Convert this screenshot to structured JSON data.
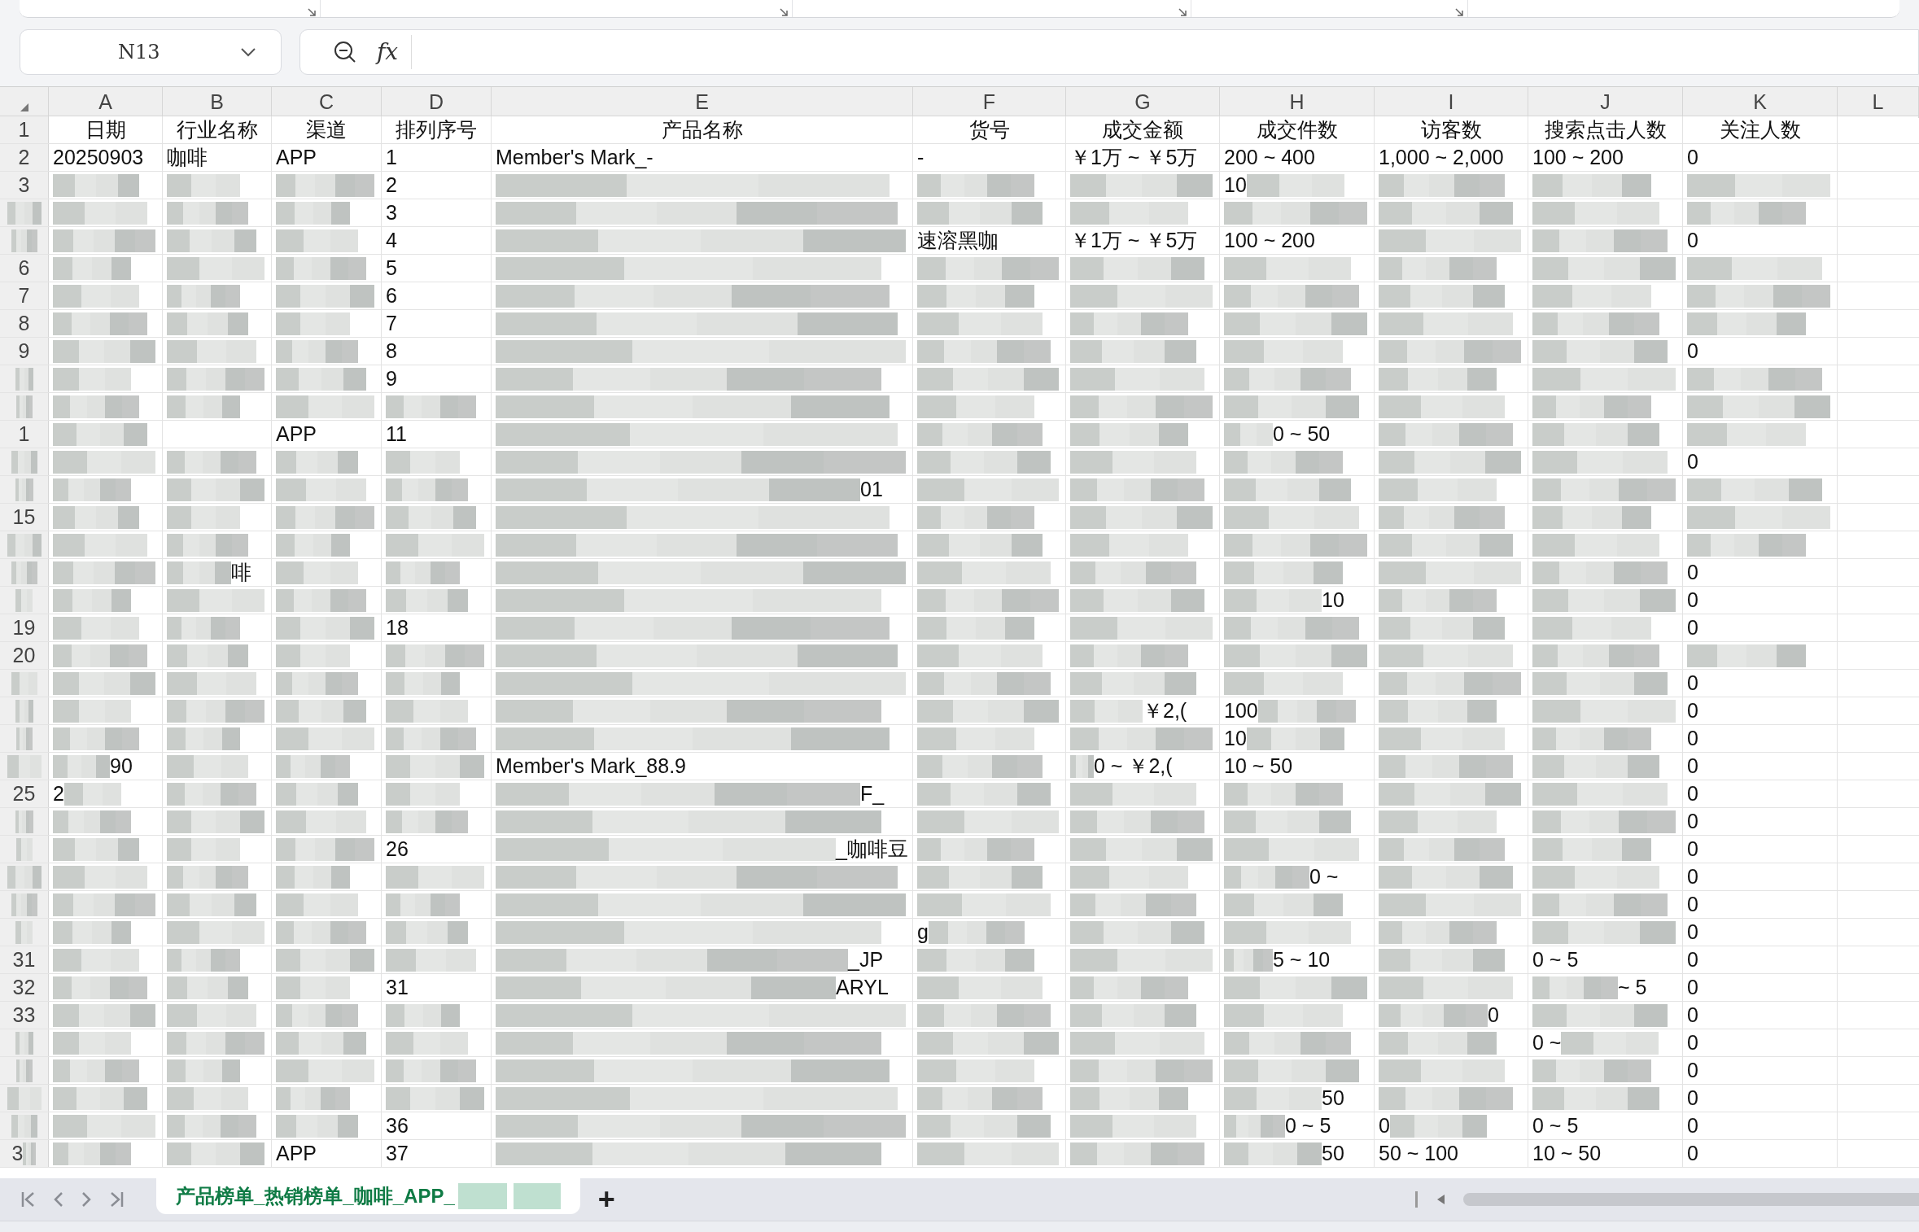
{
  "name_box": {
    "value": "N13"
  },
  "formula_bar": {
    "label": "fx"
  },
  "columns": [
    "A",
    "B",
    "C",
    "D",
    "E",
    "F",
    "G",
    "H",
    "I",
    "J",
    "K",
    "L"
  ],
  "rows": [
    {
      "header": {
        "kind": "text",
        "text": "1"
      },
      "cells": [
        {
          "kind": "text",
          "text": "日期"
        },
        {
          "kind": "text",
          "text": "行业名称"
        },
        {
          "kind": "text",
          "text": "渠道"
        },
        {
          "kind": "text",
          "text": "排列序号"
        },
        {
          "kind": "text",
          "text": "产品名称"
        },
        {
          "kind": "text",
          "text": "货号"
        },
        {
          "kind": "text",
          "text": "成交金额"
        },
        {
          "kind": "text",
          "text": "成交件数"
        },
        {
          "kind": "text",
          "text": "访客数"
        },
        {
          "kind": "text",
          "text": "搜索点击人数"
        },
        {
          "kind": "text",
          "text": "关注人数"
        }
      ]
    },
    {
      "header": {
        "kind": "text",
        "text": "2"
      },
      "cells": [
        {
          "kind": "text",
          "text": "20250903"
        },
        {
          "kind": "text",
          "text": "咖啡"
        },
        {
          "kind": "text",
          "text": "APP"
        },
        {
          "kind": "text",
          "text": "1"
        },
        {
          "kind": "text",
          "text": "Member's Mark_-"
        },
        {
          "kind": "text",
          "text": "-"
        },
        {
          "kind": "text",
          "text": "￥1万 ~ ￥5万"
        },
        {
          "kind": "text",
          "text": "200 ~ 400"
        },
        {
          "kind": "text",
          "text": "1,000 ~ 2,000"
        },
        {
          "kind": "text",
          "text": "100 ~ 200"
        },
        {
          "kind": "text",
          "text": "0"
        }
      ]
    },
    {
      "header": {
        "kind": "text",
        "text": "3"
      },
      "cells": [
        {
          "kind": "redacted"
        },
        {
          "kind": "redacted"
        },
        {
          "kind": "redacted"
        },
        {
          "kind": "text",
          "text": "2"
        },
        {
          "kind": "redacted"
        },
        {
          "kind": "redacted"
        },
        {
          "kind": "redacted"
        },
        {
          "kind": "tail_hidden",
          "text": "10"
        },
        {
          "kind": "redacted"
        },
        {
          "kind": "redacted"
        },
        {
          "kind": "redacted"
        }
      ]
    },
    {
      "header": {
        "kind": "redacted"
      },
      "cells": [
        {
          "kind": "redacted"
        },
        {
          "kind": "redacted"
        },
        {
          "kind": "redacted"
        },
        {
          "kind": "text",
          "text": "3"
        },
        {
          "kind": "redacted"
        },
        {
          "kind": "redacted"
        },
        {
          "kind": "redacted"
        },
        {
          "kind": "redacted"
        },
        {
          "kind": "redacted"
        },
        {
          "kind": "redacted"
        },
        {
          "kind": "redacted"
        }
      ]
    },
    {
      "header": {
        "kind": "redacted"
      },
      "cells": [
        {
          "kind": "redacted"
        },
        {
          "kind": "redacted"
        },
        {
          "kind": "redacted"
        },
        {
          "kind": "text",
          "text": "4"
        },
        {
          "kind": "redacted"
        },
        {
          "kind": "text",
          "text": "速溶黑咖"
        },
        {
          "kind": "text",
          "text": "￥1万 ~ ￥5万"
        },
        {
          "kind": "text",
          "text": "100 ~ 200"
        },
        {
          "kind": "redacted"
        },
        {
          "kind": "redacted"
        },
        {
          "kind": "text",
          "text": "0"
        }
      ]
    },
    {
      "header": {
        "kind": "text",
        "text": "6"
      },
      "cells": [
        {
          "kind": "redacted"
        },
        {
          "kind": "redacted"
        },
        {
          "kind": "redacted"
        },
        {
          "kind": "text",
          "text": "5"
        },
        {
          "kind": "redacted"
        },
        {
          "kind": "redacted"
        },
        {
          "kind": "redacted"
        },
        {
          "kind": "redacted"
        },
        {
          "kind": "redacted"
        },
        {
          "kind": "redacted"
        },
        {
          "kind": "redacted"
        }
      ]
    },
    {
      "header": {
        "kind": "text",
        "text": "7"
      },
      "cells": [
        {
          "kind": "redacted"
        },
        {
          "kind": "redacted"
        },
        {
          "kind": "redacted"
        },
        {
          "kind": "text",
          "text": "6"
        },
        {
          "kind": "redacted"
        },
        {
          "kind": "redacted"
        },
        {
          "kind": "redacted"
        },
        {
          "kind": "redacted"
        },
        {
          "kind": "redacted"
        },
        {
          "kind": "redacted"
        },
        {
          "kind": "redacted"
        }
      ]
    },
    {
      "header": {
        "kind": "text",
        "text": "8"
      },
      "cells": [
        {
          "kind": "redacted"
        },
        {
          "kind": "redacted"
        },
        {
          "kind": "redacted"
        },
        {
          "kind": "text",
          "text": "7"
        },
        {
          "kind": "redacted"
        },
        {
          "kind": "redacted"
        },
        {
          "kind": "redacted"
        },
        {
          "kind": "redacted"
        },
        {
          "kind": "redacted"
        },
        {
          "kind": "redacted"
        },
        {
          "kind": "redacted"
        }
      ]
    },
    {
      "header": {
        "kind": "text",
        "text": "9"
      },
      "cells": [
        {
          "kind": "redacted"
        },
        {
          "kind": "redacted"
        },
        {
          "kind": "redacted"
        },
        {
          "kind": "text",
          "text": "8"
        },
        {
          "kind": "redacted"
        },
        {
          "kind": "redacted"
        },
        {
          "kind": "redacted"
        },
        {
          "kind": "redacted"
        },
        {
          "kind": "redacted"
        },
        {
          "kind": "redacted"
        },
        {
          "kind": "text",
          "text": "0"
        }
      ]
    },
    {
      "header": {
        "kind": "redacted"
      },
      "cells": [
        {
          "kind": "redacted"
        },
        {
          "kind": "redacted"
        },
        {
          "kind": "redacted"
        },
        {
          "kind": "text",
          "text": "9"
        },
        {
          "kind": "redacted"
        },
        {
          "kind": "redacted"
        },
        {
          "kind": "redacted"
        },
        {
          "kind": "redacted"
        },
        {
          "kind": "redacted"
        },
        {
          "kind": "redacted"
        },
        {
          "kind": "redacted"
        }
      ]
    },
    {
      "header": {
        "kind": "redacted"
      },
      "cells": [
        {
          "kind": "redacted"
        },
        {
          "kind": "redacted"
        },
        {
          "kind": "redacted"
        },
        {
          "kind": "redacted"
        },
        {
          "kind": "redacted"
        },
        {
          "kind": "redacted"
        },
        {
          "kind": "redacted"
        },
        {
          "kind": "redacted"
        },
        {
          "kind": "redacted"
        },
        {
          "kind": "redacted"
        },
        {
          "kind": "redacted"
        }
      ]
    },
    {
      "header": {
        "kind": "text",
        "text": "1"
      },
      "cells": [
        {
          "kind": "redacted"
        },
        {
          "kind": "empty"
        },
        {
          "kind": "text",
          "text": "APP"
        },
        {
          "kind": "text",
          "text": "11"
        },
        {
          "kind": "redacted"
        },
        {
          "kind": "redacted"
        },
        {
          "kind": "redacted"
        },
        {
          "kind": "head_hidden",
          "text": "0 ~ 50"
        },
        {
          "kind": "redacted"
        },
        {
          "kind": "redacted"
        },
        {
          "kind": "redacted"
        }
      ]
    },
    {
      "header": {
        "kind": "redacted"
      },
      "cells": [
        {
          "kind": "redacted"
        },
        {
          "kind": "redacted"
        },
        {
          "kind": "redacted"
        },
        {
          "kind": "redacted"
        },
        {
          "kind": "redacted"
        },
        {
          "kind": "redacted"
        },
        {
          "kind": "redacted"
        },
        {
          "kind": "redacted"
        },
        {
          "kind": "redacted"
        },
        {
          "kind": "redacted"
        },
        {
          "kind": "text",
          "text": "0"
        }
      ]
    },
    {
      "header": {
        "kind": "redacted"
      },
      "cells": [
        {
          "kind": "redacted"
        },
        {
          "kind": "redacted"
        },
        {
          "kind": "redacted"
        },
        {
          "kind": "redacted"
        },
        {
          "kind": "head_hidden",
          "text": "01"
        },
        {
          "kind": "redacted"
        },
        {
          "kind": "redacted"
        },
        {
          "kind": "redacted"
        },
        {
          "kind": "redacted"
        },
        {
          "kind": "redacted"
        },
        {
          "kind": "redacted"
        }
      ]
    },
    {
      "header": {
        "kind": "text",
        "text": "15"
      },
      "cells": [
        {
          "kind": "redacted"
        },
        {
          "kind": "redacted"
        },
        {
          "kind": "redacted"
        },
        {
          "kind": "redacted"
        },
        {
          "kind": "redacted"
        },
        {
          "kind": "redacted"
        },
        {
          "kind": "redacted"
        },
        {
          "kind": "redacted"
        },
        {
          "kind": "redacted"
        },
        {
          "kind": "redacted"
        },
        {
          "kind": "redacted"
        }
      ]
    },
    {
      "header": {
        "kind": "redacted"
      },
      "cells": [
        {
          "kind": "redacted"
        },
        {
          "kind": "redacted"
        },
        {
          "kind": "redacted"
        },
        {
          "kind": "redacted"
        },
        {
          "kind": "redacted"
        },
        {
          "kind": "redacted"
        },
        {
          "kind": "redacted"
        },
        {
          "kind": "redacted"
        },
        {
          "kind": "redacted"
        },
        {
          "kind": "redacted"
        },
        {
          "kind": "redacted"
        }
      ]
    },
    {
      "header": {
        "kind": "redacted"
      },
      "cells": [
        {
          "kind": "redacted"
        },
        {
          "kind": "head_hidden",
          "text": "啡"
        },
        {
          "kind": "redacted"
        },
        {
          "kind": "redacted"
        },
        {
          "kind": "redacted"
        },
        {
          "kind": "redacted"
        },
        {
          "kind": "redacted"
        },
        {
          "kind": "redacted"
        },
        {
          "kind": "redacted"
        },
        {
          "kind": "redacted"
        },
        {
          "kind": "text",
          "text": "0"
        }
      ]
    },
    {
      "header": {
        "kind": "redacted"
      },
      "cells": [
        {
          "kind": "redacted"
        },
        {
          "kind": "redacted"
        },
        {
          "kind": "redacted"
        },
        {
          "kind": "redacted"
        },
        {
          "kind": "redacted"
        },
        {
          "kind": "redacted"
        },
        {
          "kind": "redacted"
        },
        {
          "kind": "head_hidden",
          "text": "10"
        },
        {
          "kind": "redacted"
        },
        {
          "kind": "redacted"
        },
        {
          "kind": "text",
          "text": "0"
        }
      ]
    },
    {
      "header": {
        "kind": "text",
        "text": "19"
      },
      "cells": [
        {
          "kind": "redacted"
        },
        {
          "kind": "redacted"
        },
        {
          "kind": "redacted"
        },
        {
          "kind": "text",
          "text": "18"
        },
        {
          "kind": "redacted"
        },
        {
          "kind": "redacted"
        },
        {
          "kind": "redacted"
        },
        {
          "kind": "redacted"
        },
        {
          "kind": "redacted"
        },
        {
          "kind": "redacted"
        },
        {
          "kind": "text",
          "text": "0"
        }
      ]
    },
    {
      "header": {
        "kind": "text",
        "text": "20"
      },
      "cells": [
        {
          "kind": "redacted"
        },
        {
          "kind": "redacted"
        },
        {
          "kind": "redacted"
        },
        {
          "kind": "redacted"
        },
        {
          "kind": "redacted"
        },
        {
          "kind": "redacted"
        },
        {
          "kind": "redacted"
        },
        {
          "kind": "redacted"
        },
        {
          "kind": "redacted"
        },
        {
          "kind": "redacted"
        },
        {
          "kind": "redacted"
        }
      ]
    },
    {
      "header": {
        "kind": "redacted"
      },
      "cells": [
        {
          "kind": "redacted"
        },
        {
          "kind": "redacted"
        },
        {
          "kind": "redacted"
        },
        {
          "kind": "redacted"
        },
        {
          "kind": "redacted"
        },
        {
          "kind": "redacted"
        },
        {
          "kind": "redacted"
        },
        {
          "kind": "redacted"
        },
        {
          "kind": "redacted"
        },
        {
          "kind": "redacted"
        },
        {
          "kind": "text",
          "text": "0"
        }
      ]
    },
    {
      "header": {
        "kind": "redacted"
      },
      "cells": [
        {
          "kind": "redacted"
        },
        {
          "kind": "redacted"
        },
        {
          "kind": "redacted"
        },
        {
          "kind": "redacted"
        },
        {
          "kind": "redacted"
        },
        {
          "kind": "redacted"
        },
        {
          "kind": "head_hidden",
          "text": "￥2,("
        },
        {
          "kind": "tail_hidden",
          "text": "100"
        },
        {
          "kind": "redacted"
        },
        {
          "kind": "redacted"
        },
        {
          "kind": "text",
          "text": "0"
        }
      ]
    },
    {
      "header": {
        "kind": "redacted"
      },
      "cells": [
        {
          "kind": "redacted"
        },
        {
          "kind": "redacted"
        },
        {
          "kind": "redacted"
        },
        {
          "kind": "redacted"
        },
        {
          "kind": "redacted"
        },
        {
          "kind": "redacted"
        },
        {
          "kind": "redacted"
        },
        {
          "kind": "tail_hidden",
          "text": "10"
        },
        {
          "kind": "redacted"
        },
        {
          "kind": "redacted"
        },
        {
          "kind": "text",
          "text": "0"
        }
      ]
    },
    {
      "header": {
        "kind": "redacted"
      },
      "cells": [
        {
          "kind": "head_hidden",
          "text": "90"
        },
        {
          "kind": "redacted"
        },
        {
          "kind": "redacted"
        },
        {
          "kind": "redacted"
        },
        {
          "kind": "text",
          "text": "Member's Mark_88.9"
        },
        {
          "kind": "redacted"
        },
        {
          "kind": "head_hidden",
          "text": "0 ~ ￥2,("
        },
        {
          "kind": "text",
          "text": "10 ~ 50"
        },
        {
          "kind": "redacted"
        },
        {
          "kind": "redacted"
        },
        {
          "kind": "text",
          "text": "0"
        }
      ]
    },
    {
      "header": {
        "kind": "text",
        "text": "25"
      },
      "cells": [
        {
          "kind": "tail_hidden",
          "text": "2"
        },
        {
          "kind": "redacted"
        },
        {
          "kind": "redacted"
        },
        {
          "kind": "redacted"
        },
        {
          "kind": "head_hidden",
          "text": "F_"
        },
        {
          "kind": "redacted"
        },
        {
          "kind": "redacted"
        },
        {
          "kind": "redacted"
        },
        {
          "kind": "redacted"
        },
        {
          "kind": "redacted"
        },
        {
          "kind": "text",
          "text": "0"
        }
      ]
    },
    {
      "header": {
        "kind": "redacted"
      },
      "cells": [
        {
          "kind": "redacted"
        },
        {
          "kind": "redacted"
        },
        {
          "kind": "redacted"
        },
        {
          "kind": "redacted"
        },
        {
          "kind": "redacted"
        },
        {
          "kind": "redacted"
        },
        {
          "kind": "redacted"
        },
        {
          "kind": "redacted"
        },
        {
          "kind": "redacted"
        },
        {
          "kind": "redacted"
        },
        {
          "kind": "text",
          "text": "0"
        }
      ]
    },
    {
      "header": {
        "kind": "redacted"
      },
      "cells": [
        {
          "kind": "redacted"
        },
        {
          "kind": "redacted"
        },
        {
          "kind": "redacted"
        },
        {
          "kind": "text",
          "text": "26"
        },
        {
          "kind": "head_hidden",
          "text": "_咖啡豆"
        },
        {
          "kind": "redacted"
        },
        {
          "kind": "redacted"
        },
        {
          "kind": "redacted"
        },
        {
          "kind": "redacted"
        },
        {
          "kind": "redacted"
        },
        {
          "kind": "text",
          "text": "0"
        }
      ]
    },
    {
      "header": {
        "kind": "redacted"
      },
      "cells": [
        {
          "kind": "redacted"
        },
        {
          "kind": "redacted"
        },
        {
          "kind": "redacted"
        },
        {
          "kind": "redacted"
        },
        {
          "kind": "redacted"
        },
        {
          "kind": "redacted"
        },
        {
          "kind": "redacted"
        },
        {
          "kind": "head_hidden",
          "text": "0 ~"
        },
        {
          "kind": "redacted"
        },
        {
          "kind": "redacted"
        },
        {
          "kind": "text",
          "text": "0"
        }
      ]
    },
    {
      "header": {
        "kind": "redacted"
      },
      "cells": [
        {
          "kind": "redacted"
        },
        {
          "kind": "redacted"
        },
        {
          "kind": "redacted"
        },
        {
          "kind": "redacted"
        },
        {
          "kind": "redacted"
        },
        {
          "kind": "redacted"
        },
        {
          "kind": "redacted"
        },
        {
          "kind": "redacted"
        },
        {
          "kind": "redacted"
        },
        {
          "kind": "redacted"
        },
        {
          "kind": "text",
          "text": "0"
        }
      ]
    },
    {
      "header": {
        "kind": "redacted"
      },
      "cells": [
        {
          "kind": "redacted"
        },
        {
          "kind": "redacted"
        },
        {
          "kind": "redacted"
        },
        {
          "kind": "redacted"
        },
        {
          "kind": "redacted"
        },
        {
          "kind": "tail_hidden",
          "text": "g"
        },
        {
          "kind": "redacted"
        },
        {
          "kind": "redacted"
        },
        {
          "kind": "redacted"
        },
        {
          "kind": "redacted"
        },
        {
          "kind": "text",
          "text": "0"
        }
      ]
    },
    {
      "header": {
        "kind": "text",
        "text": "31"
      },
      "cells": [
        {
          "kind": "redacted"
        },
        {
          "kind": "redacted"
        },
        {
          "kind": "redacted"
        },
        {
          "kind": "redacted"
        },
        {
          "kind": "head_hidden",
          "text": "_JP"
        },
        {
          "kind": "redacted"
        },
        {
          "kind": "redacted"
        },
        {
          "kind": "head_hidden",
          "text": "5 ~ 10"
        },
        {
          "kind": "redacted"
        },
        {
          "kind": "text",
          "text": "0 ~ 5"
        },
        {
          "kind": "text",
          "text": "0"
        }
      ]
    },
    {
      "header": {
        "kind": "text",
        "text": "32"
      },
      "cells": [
        {
          "kind": "redacted"
        },
        {
          "kind": "redacted"
        },
        {
          "kind": "redacted"
        },
        {
          "kind": "text",
          "text": "31"
        },
        {
          "kind": "head_hidden",
          "text": "ARYL"
        },
        {
          "kind": "redacted"
        },
        {
          "kind": "redacted"
        },
        {
          "kind": "redacted"
        },
        {
          "kind": "redacted"
        },
        {
          "kind": "head_hidden",
          "text": "~ 5"
        },
        {
          "kind": "text",
          "text": "0"
        }
      ]
    },
    {
      "header": {
        "kind": "text",
        "text": "33"
      },
      "cells": [
        {
          "kind": "redacted"
        },
        {
          "kind": "redacted"
        },
        {
          "kind": "redacted"
        },
        {
          "kind": "redacted"
        },
        {
          "kind": "redacted"
        },
        {
          "kind": "redacted"
        },
        {
          "kind": "redacted"
        },
        {
          "kind": "redacted"
        },
        {
          "kind": "head_hidden",
          "text": "0"
        },
        {
          "kind": "redacted"
        },
        {
          "kind": "text",
          "text": "0"
        }
      ]
    },
    {
      "header": {
        "kind": "redacted"
      },
      "cells": [
        {
          "kind": "redacted"
        },
        {
          "kind": "redacted"
        },
        {
          "kind": "redacted"
        },
        {
          "kind": "redacted"
        },
        {
          "kind": "redacted"
        },
        {
          "kind": "redacted"
        },
        {
          "kind": "redacted"
        },
        {
          "kind": "redacted"
        },
        {
          "kind": "redacted"
        },
        {
          "kind": "tail_hidden",
          "text": "0 ~"
        },
        {
          "kind": "text",
          "text": "0"
        }
      ]
    },
    {
      "header": {
        "kind": "redacted"
      },
      "cells": [
        {
          "kind": "redacted"
        },
        {
          "kind": "redacted"
        },
        {
          "kind": "redacted"
        },
        {
          "kind": "redacted"
        },
        {
          "kind": "redacted"
        },
        {
          "kind": "redacted"
        },
        {
          "kind": "redacted"
        },
        {
          "kind": "redacted"
        },
        {
          "kind": "redacted"
        },
        {
          "kind": "redacted"
        },
        {
          "kind": "text",
          "text": "0"
        }
      ]
    },
    {
      "header": {
        "kind": "redacted"
      },
      "cells": [
        {
          "kind": "redacted"
        },
        {
          "kind": "redacted"
        },
        {
          "kind": "redacted"
        },
        {
          "kind": "redacted"
        },
        {
          "kind": "redacted"
        },
        {
          "kind": "redacted"
        },
        {
          "kind": "redacted"
        },
        {
          "kind": "head_hidden",
          "text": "50"
        },
        {
          "kind": "redacted"
        },
        {
          "kind": "redacted"
        },
        {
          "kind": "text",
          "text": "0"
        }
      ]
    },
    {
      "header": {
        "kind": "redacted"
      },
      "cells": [
        {
          "kind": "redacted"
        },
        {
          "kind": "redacted"
        },
        {
          "kind": "redacted"
        },
        {
          "kind": "text",
          "text": "36"
        },
        {
          "kind": "redacted"
        },
        {
          "kind": "redacted"
        },
        {
          "kind": "redacted"
        },
        {
          "kind": "head_hidden",
          "text": "0 ~ 5"
        },
        {
          "kind": "tail_hidden",
          "text": "0"
        },
        {
          "kind": "text",
          "text": "0 ~ 5"
        },
        {
          "kind": "text",
          "text": "0"
        }
      ]
    },
    {
      "header": {
        "kind": "tail_hidden",
        "text": "3"
      },
      "cells": [
        {
          "kind": "redacted"
        },
        {
          "kind": "redacted"
        },
        {
          "kind": "text",
          "text": "APP"
        },
        {
          "kind": "text",
          "text": "37"
        },
        {
          "kind": "redacted"
        },
        {
          "kind": "redacted"
        },
        {
          "kind": "redacted"
        },
        {
          "kind": "head_hidden",
          "text": "50"
        },
        {
          "kind": "text",
          "text": "50 ~ 100"
        },
        {
          "kind": "text",
          "text": "10 ~ 50"
        },
        {
          "kind": "text",
          "text": "0"
        }
      ]
    }
  ],
  "sheet_tabs": [
    {
      "label": "产品榜单_热销榜单_咖啡_APP_",
      "selected": true,
      "kind": "tail_hidden"
    }
  ],
  "add_sheet": {
    "label": "+"
  }
}
